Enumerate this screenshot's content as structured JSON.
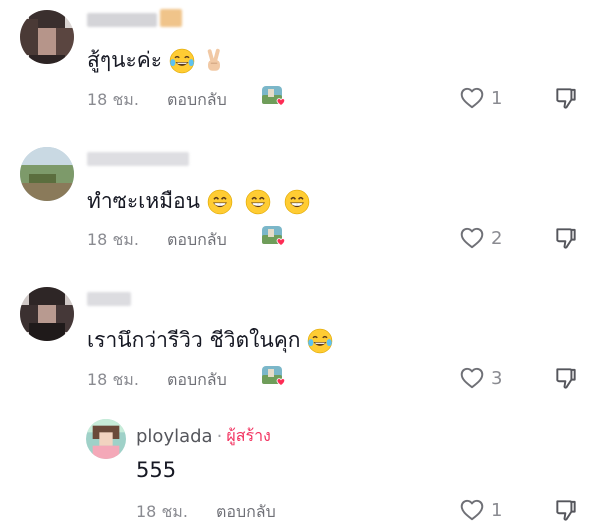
{
  "colors": {
    "accent": "#fe2c55",
    "text": "#161823",
    "muted": "#8a8b91"
  },
  "icons": {
    "like": "heart-outline-icon",
    "dislike": "thumbs-down-icon",
    "creator_liked": "creator-liked-avatar-icon"
  },
  "comments": [
    {
      "text": "สู้ๆนะค่ะ",
      "emojis": [
        "face-with-tears-of-joy-emoji",
        "victory-hand-emoji"
      ],
      "time": "18 ชม.",
      "reply_label": "ตอบกลับ",
      "likes": "1"
    },
    {
      "text": "ทำซะเหมือน",
      "emojis": [
        "grinning-face-emoji",
        "grinning-face-emoji",
        "grinning-face-emoji"
      ],
      "time": "18 ชม.",
      "reply_label": "ตอบกลับ",
      "likes": "2"
    },
    {
      "text": "เรานึกว่ารีวิว ชีวิตในคุก",
      "emojis": [
        "face-with-tears-of-joy-emoji"
      ],
      "time": "18 ชม.",
      "reply_label": "ตอบกลับ",
      "likes": "3"
    }
  ],
  "reply": {
    "username": "ploylada",
    "separator": "·",
    "creator_label": "ผู้สร้าง",
    "text": "555",
    "time": "18 ชม.",
    "reply_label": "ตอบกลับ",
    "likes": "1"
  }
}
